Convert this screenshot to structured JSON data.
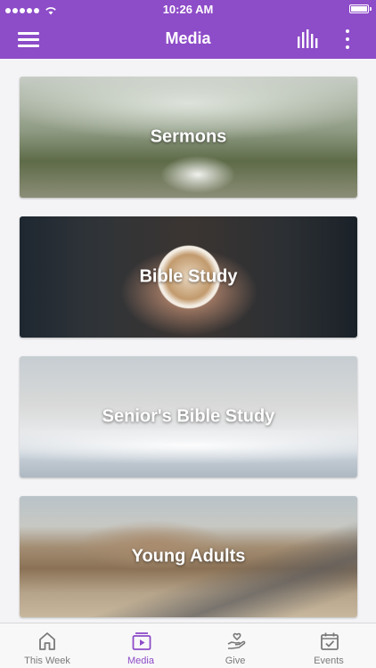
{
  "status_bar": {
    "time": "10:26 AM"
  },
  "nav": {
    "title": "Media",
    "menu_icon": "hamburger-icon",
    "bars_icon": "bars-icon",
    "more_icon": "more-vertical-icon"
  },
  "colors": {
    "brand": "#8d4cc8",
    "tab_inactive": "#7a7a7a"
  },
  "cards": [
    {
      "label": "Sermons"
    },
    {
      "label": "Bible Study"
    },
    {
      "label": "Senior's Bible Study"
    },
    {
      "label": "Young Adults"
    }
  ],
  "tabs": [
    {
      "label": "This Week",
      "icon": "home-icon",
      "active": false
    },
    {
      "label": "Media",
      "icon": "media-player-icon",
      "active": true
    },
    {
      "label": "Give",
      "icon": "heart-hand-icon",
      "active": false
    },
    {
      "label": "Events",
      "icon": "calendar-check-icon",
      "active": false
    }
  ]
}
